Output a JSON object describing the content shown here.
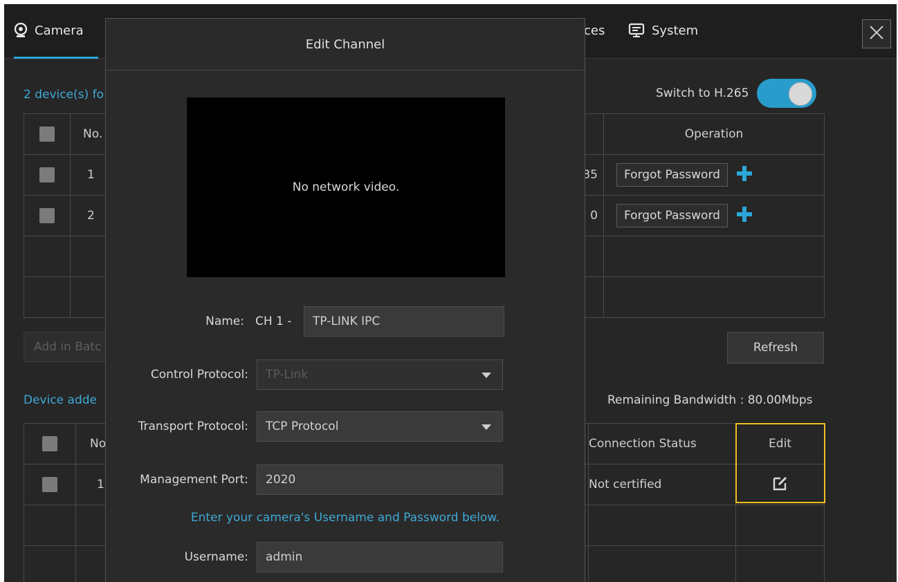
{
  "tabs": {
    "camera": "Camera",
    "devices_partial": "ces",
    "system": "System"
  },
  "found": {
    "label_partial": "2 device(s) fo",
    "switch_label": "Switch to H.265",
    "columns": {
      "no": "No.",
      "operation": "Operation"
    },
    "rows": [
      {
        "no": "1",
        "port_partial": "35",
        "forgot": "Forgot Password"
      },
      {
        "no": "2",
        "port_partial": "0",
        "forgot": "Forgot Password"
      }
    ],
    "batch_partial": "Add in Batc",
    "refresh": "Refresh"
  },
  "added": {
    "label_partial": "Device adde",
    "bandwidth": "Remaining Bandwidth : 80.00Mbps",
    "columns": {
      "no_partial": "No",
      "status": "Connection Status",
      "edit": "Edit"
    },
    "rows": [
      {
        "no_partial": "1",
        "status": "Not certified"
      }
    ]
  },
  "modal": {
    "title": "Edit Channel",
    "video_message": "No network video.",
    "name_label": "Name:",
    "name_prefix": "CH 1 -",
    "name_value": "TP-LINK IPC",
    "control_label": "Control Protocol:",
    "control_value": "TP-Link",
    "transport_label": "Transport Protocol:",
    "transport_value": "TCP Protocol",
    "port_label": "Management Port:",
    "port_value": "2020",
    "hint": "Enter your camera's Username and Password below.",
    "username_label": "Username:",
    "username_value": "admin"
  },
  "colors": {
    "accent": "#2aa7d8",
    "highlight": "#f0c020",
    "background": "#262626"
  }
}
